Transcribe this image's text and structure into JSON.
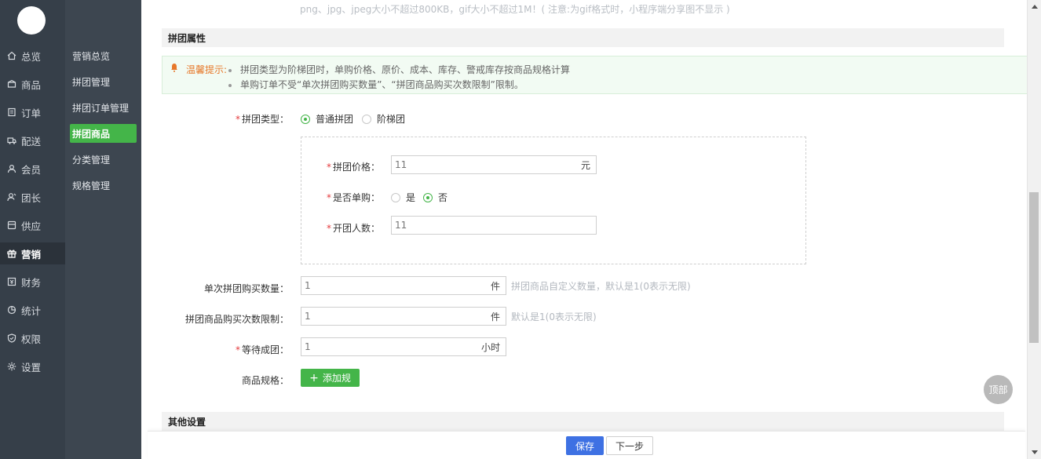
{
  "nav_primary": [
    {
      "label": "总览",
      "icon": "home-icon"
    },
    {
      "label": "商品",
      "icon": "box-icon"
    },
    {
      "label": "订单",
      "icon": "order-icon"
    },
    {
      "label": "配送",
      "icon": "delivery-icon"
    },
    {
      "label": "会员",
      "icon": "user-icon"
    },
    {
      "label": "团长",
      "icon": "leader-icon"
    },
    {
      "label": "供应",
      "icon": "supply-icon"
    },
    {
      "label": "营销",
      "icon": "gift-icon",
      "active": true
    },
    {
      "label": "财务",
      "icon": "finance-icon"
    },
    {
      "label": "统计",
      "icon": "chart-icon"
    },
    {
      "label": "权限",
      "icon": "shield-icon"
    },
    {
      "label": "设置",
      "icon": "gear-icon"
    }
  ],
  "nav_secondary": [
    {
      "label": "营销总览"
    },
    {
      "label": "拼团管理"
    },
    {
      "label": "拼团订单管理"
    },
    {
      "label": "拼团商品",
      "active": true
    },
    {
      "label": "分类管理"
    },
    {
      "label": "规格管理"
    }
  ],
  "top_note": "png、jpg、jpeg大小不超过800KB，gif大小不超过1M！( 注意:为gif格式时，小程序端分享图不显示 )",
  "section_group": "拼团属性",
  "tip": {
    "head": "温馨提示:",
    "lines": [
      "拼团类型为阶梯团时，单购价格、原价、成本、库存、警戒库存按商品规格计算",
      "单购订单不受“单次拼团购买数量”、“拼团商品购买次数限制”限制。"
    ]
  },
  "group_type": {
    "label": "拼团类型：",
    "options": [
      "普通拼团",
      "阶梯团"
    ],
    "selected": "普通拼团"
  },
  "group_price": {
    "label": "拼团价格：",
    "value": "11",
    "unit": "元"
  },
  "single_buy": {
    "label": "是否单购：",
    "options": [
      "是",
      "否"
    ],
    "selected": "否"
  },
  "group_size": {
    "label": "开团人数：",
    "value": "11"
  },
  "per_purchase": {
    "label": "单次拼团购买数量：",
    "value": "1",
    "unit": "件",
    "hint": "拼团商品自定义数量，默认是1(0表示无限)"
  },
  "purchase_limit": {
    "label": "拼团商品购买次数限制：",
    "value": "1",
    "unit": "件",
    "hint": "默认是1(0表示无限)"
  },
  "wait_time": {
    "label": "等待成团：",
    "value": "1",
    "unit": "小时"
  },
  "spec": {
    "label": "商品规格：",
    "button": "添加规"
  },
  "section_other": "其他设置",
  "footer": {
    "save": "保存",
    "next": "下一步"
  },
  "back_top": "顶部",
  "colors": {
    "accent_green": "#44b549",
    "primary_blue": "#3e71e3",
    "required_red": "#e4393c",
    "tip_orange": "#e7782a"
  }
}
